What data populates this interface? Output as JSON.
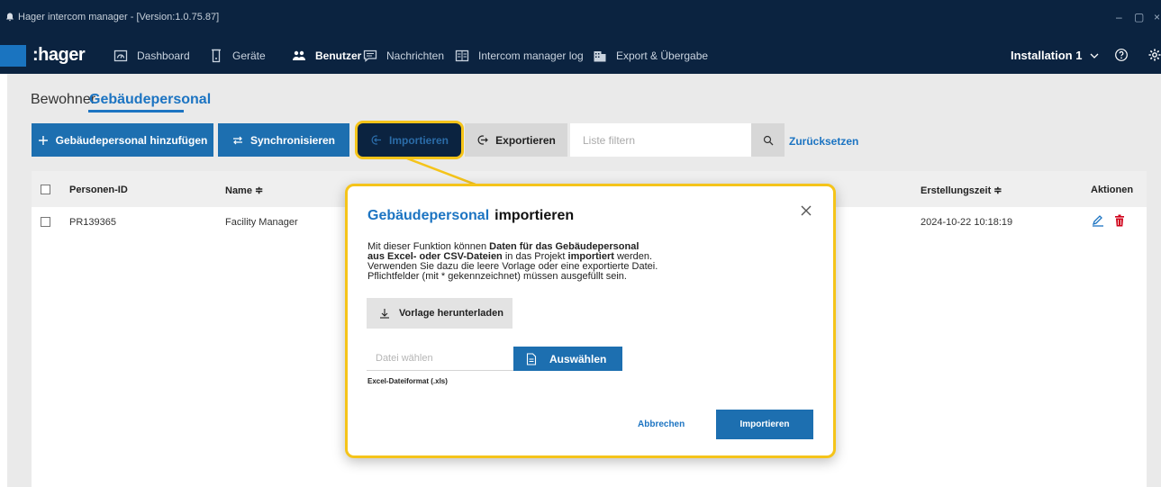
{
  "window": {
    "title": "Hager intercom manager - [Version:1.0.75.87]",
    "controls": [
      "–",
      "▢",
      "×"
    ]
  },
  "nav": {
    "logo": ":hager",
    "items": [
      {
        "label": "Dashboard",
        "icon": "dashboard-icon"
      },
      {
        "label": "Geräte",
        "icon": "device-icon"
      },
      {
        "label": "Benutzer",
        "icon": "users-icon",
        "active": true
      },
      {
        "label": "Nachrichten",
        "icon": "message-icon"
      },
      {
        "label": "Intercom manager log",
        "icon": "log-icon"
      },
      {
        "label": "Export & Übergabe",
        "icon": "building-icon"
      }
    ],
    "installation": "Installation 1",
    "icons": [
      "chevron-down-icon",
      "help-icon",
      "settings-icon"
    ]
  },
  "tabs": [
    {
      "label": "Bewohner"
    },
    {
      "label": "Gebäudepersonal",
      "active": true
    }
  ],
  "toolbar": {
    "add_label": "Gebäudepersonal hinzufügen",
    "sync_label": "Synchronisieren",
    "import_label": "Importieren",
    "export_label": "Exportieren",
    "filter_placeholder": "Liste filtern",
    "reset_label": "Zurücksetzen"
  },
  "table": {
    "headers": {
      "id": "Personen-ID",
      "name": "Name ≑",
      "created": "Erstellungszeit ≑",
      "actions": "Aktionen"
    },
    "rows": [
      {
        "id": "PR139365",
        "name": "Facility Manager",
        "created": "2024-10-22 10:18:19"
      }
    ]
  },
  "modal": {
    "title_part1": "Gebäudepersonal",
    "title_part2": "importieren",
    "desc": {
      "t1": "Mit dieser Funktion können ",
      "b1": "Daten für das Gebäudepersonal",
      "b2": "aus Excel- oder CSV-Dateien",
      "t2": " in das Projekt ",
      "b3": "importiert",
      "t3": " werden.",
      "t4": "Verwenden Sie dazu die leere Vorlage oder eine exportierte Datei.",
      "t5": "Pflichtfelder (mit * gekennzeichnet) müssen ausgefüllt sein."
    },
    "download_label": "Vorlage herunterladen",
    "file_placeholder": "Datei wählen",
    "choose_label": "Auswählen",
    "format_hint": "Excel-Dateiformat (.xls)",
    "cancel_label": "Abbrechen",
    "import_label": "Importieren"
  },
  "colors": {
    "navy": "#0b2340",
    "primary": "#1d6fb0",
    "link": "#1c74c2",
    "highlight": "#f5c41a",
    "delete": "#d0021b"
  }
}
